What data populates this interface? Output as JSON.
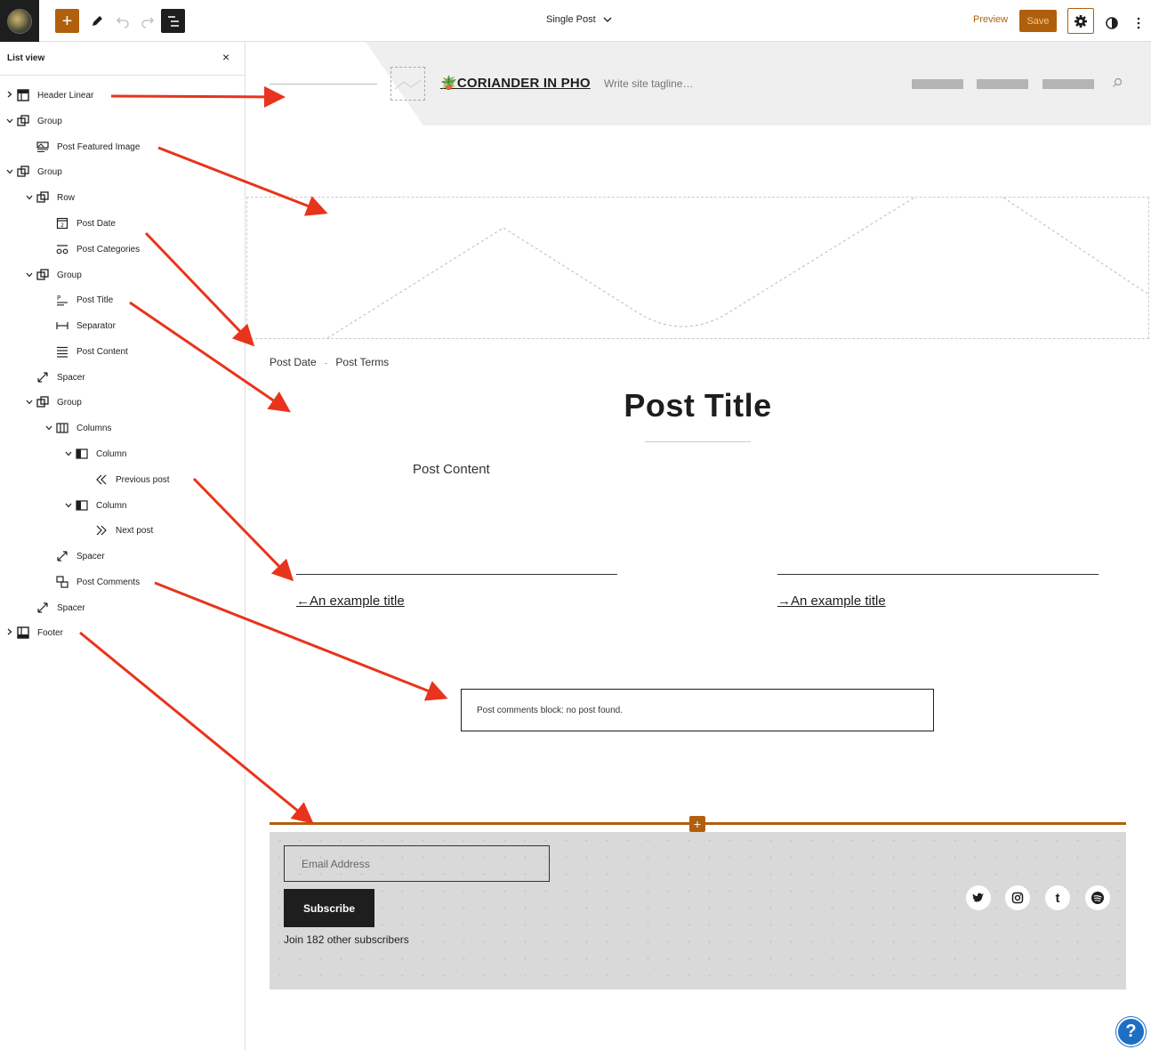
{
  "toolbar": {
    "add_label": "+",
    "document_title": "Single Post",
    "preview_label": "Preview",
    "save_label": "Save"
  },
  "list_view": {
    "title": "List view",
    "close_label": "×",
    "items": [
      {
        "label": "Header Linear",
        "icon": "template-part-icon",
        "expanded": false
      },
      {
        "label": "Group",
        "icon": "group-icon",
        "expanded": true
      },
      {
        "label": "Post Featured Image",
        "icon": "featured-image-icon"
      },
      {
        "label": "Group",
        "icon": "group-icon",
        "expanded": true
      },
      {
        "label": "Row",
        "icon": "row-icon",
        "expanded": true
      },
      {
        "label": "Post Date",
        "icon": "post-date-icon"
      },
      {
        "label": "Post Categories",
        "icon": "categories-icon"
      },
      {
        "label": "Group",
        "icon": "group-icon",
        "expanded": true
      },
      {
        "label": "Post Title",
        "icon": "post-title-icon"
      },
      {
        "label": "Separator",
        "icon": "separator-icon"
      },
      {
        "label": "Post Content",
        "icon": "post-content-icon"
      },
      {
        "label": "Spacer",
        "icon": "spacer-icon"
      },
      {
        "label": "Group",
        "icon": "group-icon",
        "expanded": true
      },
      {
        "label": "Columns",
        "icon": "columns-icon",
        "expanded": true
      },
      {
        "label": "Column",
        "icon": "column-icon",
        "expanded": true
      },
      {
        "label": "Previous post",
        "icon": "previous-post-icon"
      },
      {
        "label": "Column",
        "icon": "column-icon",
        "expanded": true
      },
      {
        "label": "Next post",
        "icon": "next-post-icon"
      },
      {
        "label": "Spacer",
        "icon": "spacer-icon"
      },
      {
        "label": "Post Comments",
        "icon": "post-comments-icon"
      },
      {
        "label": "Spacer",
        "icon": "spacer-icon"
      },
      {
        "label": "Footer",
        "icon": "footer-icon",
        "expanded": false
      }
    ]
  },
  "canvas": {
    "site_title": "CORIANDER IN PHO",
    "site_tagline": "Write site tagline…",
    "post_date": "Post Date",
    "meta_separator": "·",
    "post_terms": "Post Terms",
    "post_title": "Post Title",
    "post_content": "Post Content",
    "previous_link": "←An example title",
    "next_link": "→An example title",
    "comments_message": "Post comments block: no post found.",
    "footer": {
      "add_label": "+",
      "email_placeholder": "Email Address",
      "subscribe_label": "Subscribe",
      "subscribers_text": "Join 182 other subscribers",
      "social": [
        {
          "name": "twitter-icon"
        },
        {
          "name": "instagram-icon"
        },
        {
          "name": "tumblr-icon",
          "glyph": "t"
        },
        {
          "name": "spotify-icon"
        }
      ]
    }
  },
  "help_label": "?",
  "colors": {
    "accent": "#b0600c",
    "arrow": "#e8341c",
    "help": "#1d6fc4"
  }
}
